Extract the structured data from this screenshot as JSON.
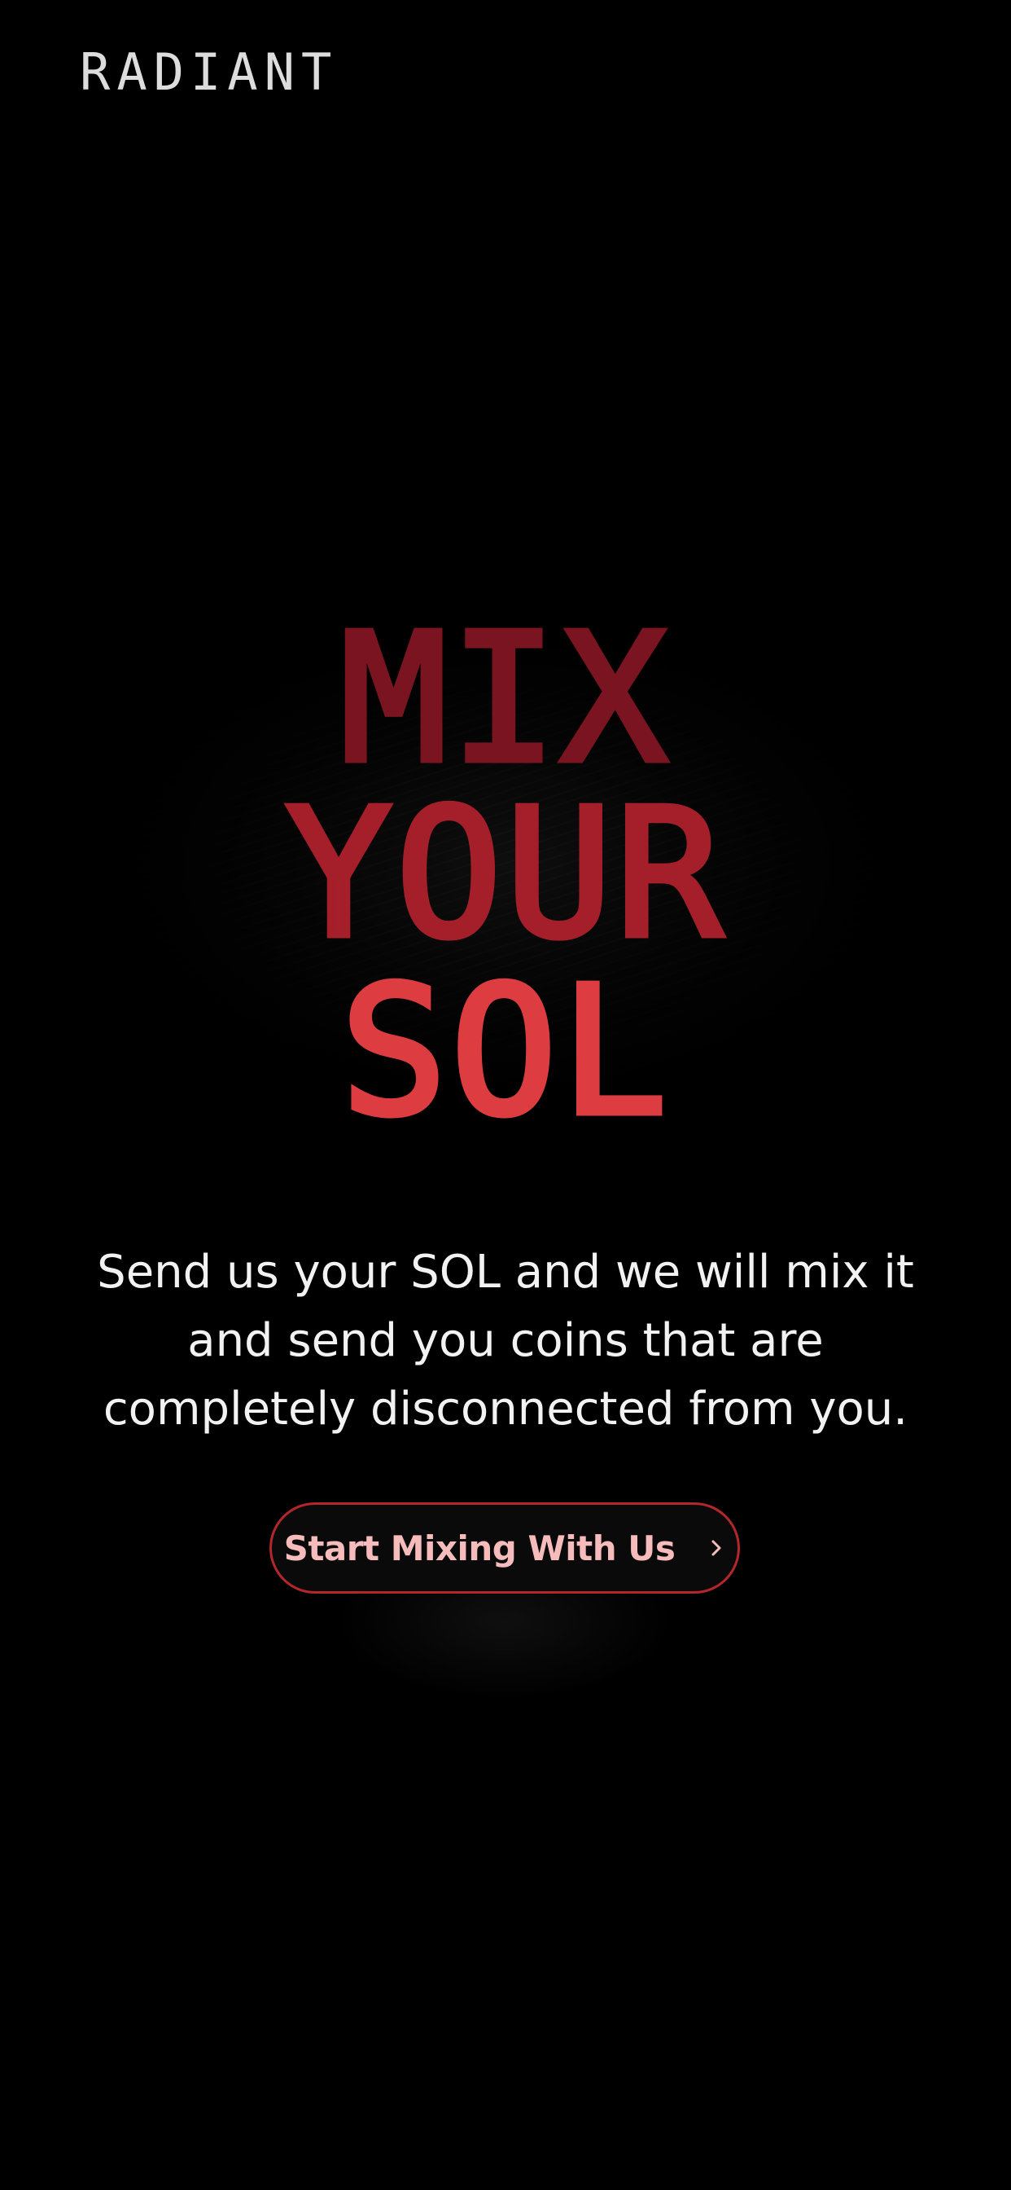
{
  "brand": {
    "logo_text": "RADIANT"
  },
  "hero": {
    "line_1": "MIX",
    "line_2": "YOUR",
    "line_3": "SOL",
    "colors": {
      "line_1": "#7a1420",
      "line_2": "#a51f2a",
      "line_3": "#dd3c40"
    },
    "tagline": "Send us your SOL and we will mix it and send you coins that are completely disconnected from you."
  },
  "cta": {
    "label": "Start Mixing With Us",
    "icon": "chevron-right-icon",
    "border_color": "#b3262c",
    "text_color": "#f6bcbc"
  }
}
